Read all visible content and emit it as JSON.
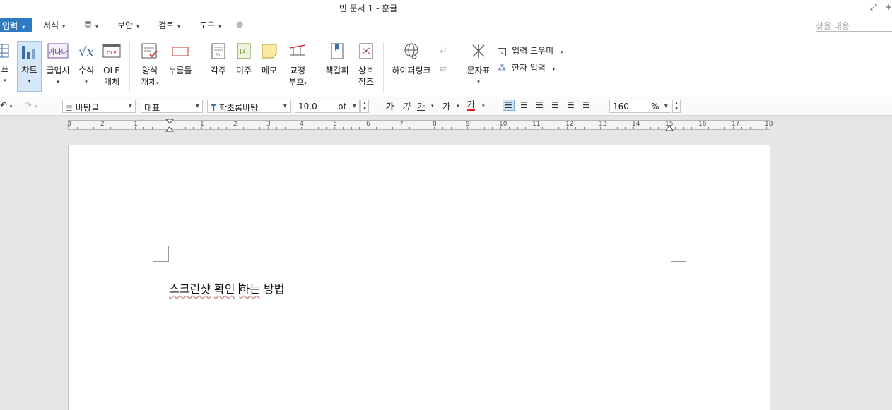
{
  "window": {
    "title": "빈 문서 1 - 훈글"
  },
  "menu": {
    "active": "입력",
    "items": [
      "서식",
      "쪽",
      "보안",
      "검토",
      "도구"
    ],
    "find_placeholder": "찾을 내용"
  },
  "ribbon": {
    "table": "표",
    "chart": "차트",
    "glyph": "글맵시",
    "formula": "수식",
    "ole_l1": "OLE",
    "ole_l2": "개체",
    "ole_icon_text": "OLE",
    "form_l1": "양식",
    "form_l2": "개체",
    "stamp": "누름틀",
    "footnote": "각주",
    "endnote": "미주",
    "memo": "메모",
    "proof_l1": "교정",
    "proof_l2": "부호",
    "bookmark": "책갈피",
    "xref_l1": "상호",
    "xref_l2": "참조",
    "hyperlink": "하이퍼링크",
    "charmap": "문자표",
    "input_helper": "입력 도우미",
    "hanja_input": "한자 입력"
  },
  "format": {
    "style": "바탕글",
    "lang": "대표",
    "font": "함초롬바탕",
    "size": "10.0",
    "unit": "pt",
    "bold_glyph": "가",
    "italic_glyph": "가",
    "underline_glyph": "가",
    "strike_glyph": "가",
    "color_glyph": "가",
    "zoom": "160",
    "zoom_unit": "%"
  },
  "ruler": {
    "labels": [
      "3",
      "2",
      "1",
      "",
      "1",
      "2",
      "3",
      "4",
      "5",
      "6",
      "7",
      "8",
      "9",
      "10",
      "11",
      "12",
      "13",
      "14",
      "15",
      "16",
      "17",
      "18"
    ]
  },
  "document": {
    "word1": "스크린샷",
    "word2": "확인",
    "word3": "하는",
    "word4": "방법"
  }
}
